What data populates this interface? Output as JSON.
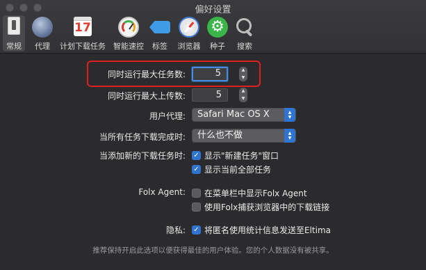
{
  "window": {
    "title": "偏好设置"
  },
  "toolbar": {
    "items": [
      {
        "label": "常规",
        "icon": "general-icon",
        "selected": true
      },
      {
        "label": "代理",
        "icon": "globe-icon"
      },
      {
        "label": "计划下载任务",
        "icon": "calendar-icon",
        "calendar_day": "17"
      },
      {
        "label": "智能速控",
        "icon": "speedometer-icon"
      },
      {
        "label": "标签",
        "icon": "tag-icon"
      },
      {
        "label": "浏览器",
        "icon": "compass-icon"
      },
      {
        "label": "种子",
        "icon": "gear-icon"
      },
      {
        "label": "搜索",
        "icon": "search-icon"
      }
    ]
  },
  "settings": {
    "max_tasks": {
      "label": "同时运行最大任务数:",
      "value": "5"
    },
    "max_uploads": {
      "label": "同时运行最大上传数:",
      "value": "5"
    },
    "user_agent": {
      "label": "用户代理:",
      "value": "Safari Mac OS X"
    },
    "on_complete": {
      "label": "当所有任务下载完成时:",
      "value": "什么也不做"
    },
    "on_add": {
      "label": "当添加新的下载任务时:",
      "show_new_task_window": {
        "label": "显示\"新建任务\"窗口",
        "checked": true
      },
      "show_all_tasks": {
        "label": "显示当前全部任务",
        "checked": true
      }
    },
    "folx_agent": {
      "label": "Folx Agent:",
      "show_in_menubar": {
        "label": "在菜单栏中显示Folx Agent",
        "checked": false
      },
      "capture_browser": {
        "label": "使用Folx捕获浏览器中的下载链接",
        "checked": false
      }
    },
    "privacy": {
      "label": "隐私:",
      "send_stats": {
        "label": "将匿名使用统计信息发送至Eltima",
        "checked": true
      }
    },
    "note": "推荐保持开启此选项以便获得最佳的用户体验。您的个人数据没有被共享。"
  },
  "colors": {
    "accent": "#2f74d0",
    "highlight": "#e02020",
    "background": "#2b2b2d"
  }
}
